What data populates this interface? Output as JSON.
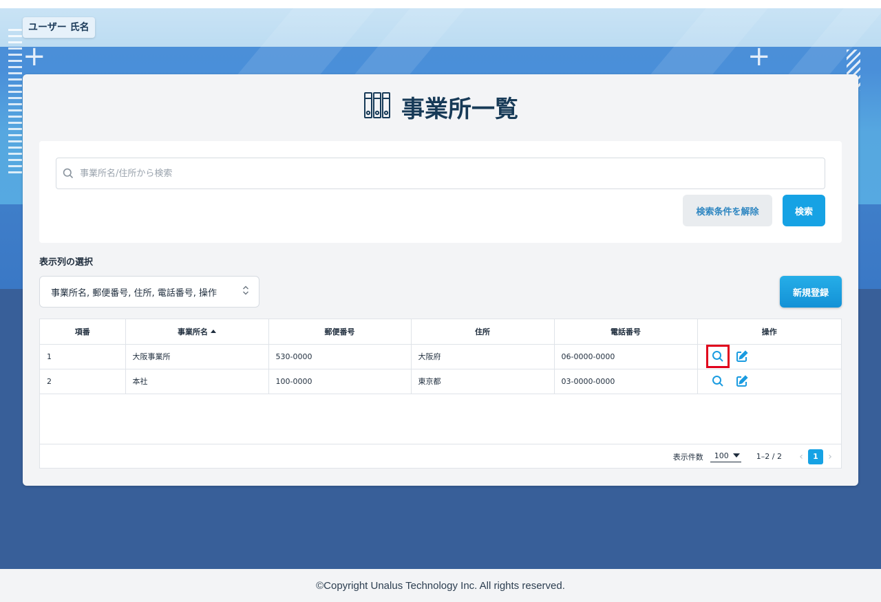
{
  "header": {
    "user_name": "ユーザー 氏名"
  },
  "page": {
    "title": "事業所一覧",
    "title_icon": "binders-icon"
  },
  "search": {
    "placeholder": "事業所名/住所から検索",
    "value": "",
    "clear_label": "検索条件を解除",
    "search_label": "検索"
  },
  "columns_select": {
    "label": "表示列の選択",
    "value": "事業所名, 郵便番号, 住所, 電話番号, 操作"
  },
  "new_button": {
    "label": "新規登録"
  },
  "table": {
    "headers": [
      "項番",
      "事業所名",
      "郵便番号",
      "住所",
      "電話番号",
      "操作"
    ],
    "rows": [
      {
        "no": "1",
        "name": "大阪事業所",
        "postal": "530-0000",
        "address": "大阪府",
        "phone": "06-0000-0000"
      },
      {
        "no": "2",
        "name": "本社",
        "postal": "100-0000",
        "address": "東京都",
        "phone": "03-0000-0000"
      }
    ]
  },
  "pagination": {
    "rows_label": "表示件数",
    "rows_per_page": "100",
    "range": "1–2 / 2",
    "current_page": "1"
  },
  "footer": {
    "copyright": "©Copyright Unalus Technology Inc. All rights reserved."
  },
  "colors": {
    "accent": "#16a2e4",
    "title": "#173a57",
    "highlight": "#e0001b",
    "background_lower": "#385f99"
  }
}
